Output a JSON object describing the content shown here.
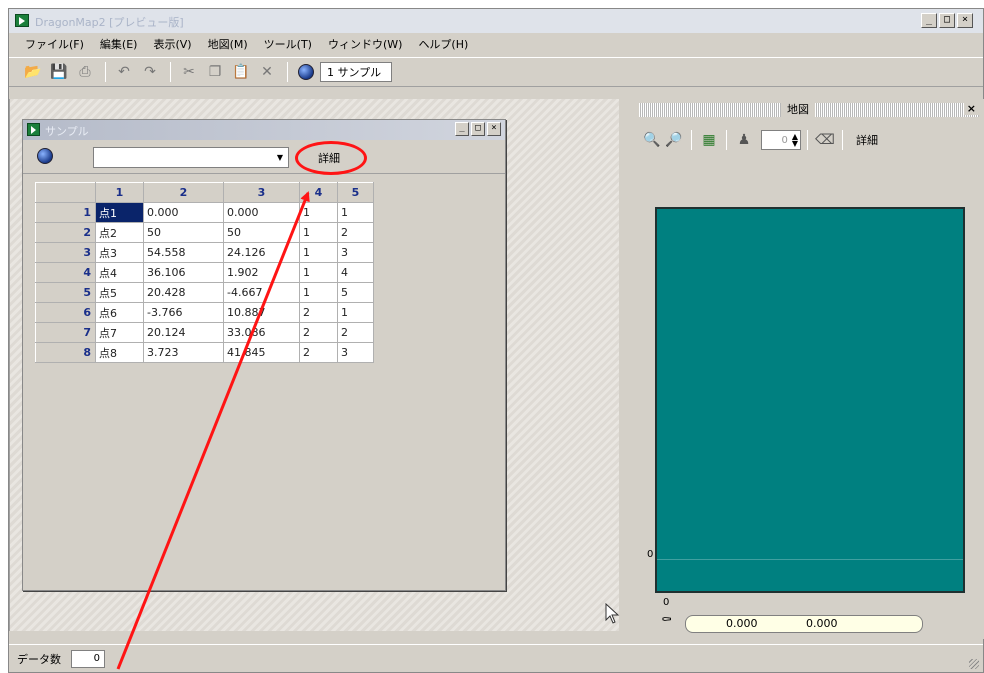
{
  "window": {
    "title": "DragonMap2 [プレビュー版]",
    "controls": {
      "minimize": "_",
      "maximize": "□",
      "close": "×"
    }
  },
  "menu": [
    {
      "label": "ファイル(F)"
    },
    {
      "label": "編集(E)"
    },
    {
      "label": "表示(V)"
    },
    {
      "label": "地図(M)"
    },
    {
      "label": "ツール(T)"
    },
    {
      "label": "ウィンドウ(W)"
    },
    {
      "label": "ヘルプ(H)"
    }
  ],
  "toolbar": {
    "icons": [
      "open-icon",
      "save-icon",
      "print-icon",
      "undo-icon",
      "redo-icon",
      "cut-icon",
      "copy-icon",
      "paste-icon",
      "delete-icon",
      "globe-icon"
    ],
    "combo_value": "1 サンプル"
  },
  "child_window": {
    "title": "サンプル",
    "name_combo_value": "",
    "detail_button_label": "詳細",
    "grid": {
      "columns": [
        "1",
        "2",
        "3",
        "4",
        "5"
      ],
      "rows": [
        {
          "index": "1",
          "cells": [
            "点1",
            "0.000",
            "0.000",
            "1",
            "1"
          ]
        },
        {
          "index": "2",
          "cells": [
            "点2",
            "50",
            "50",
            "1",
            "2"
          ]
        },
        {
          "index": "3",
          "cells": [
            "点3",
            "54.558",
            "24.126",
            "1",
            "3"
          ]
        },
        {
          "index": "4",
          "cells": [
            "点4",
            "36.106",
            "1.902",
            "1",
            "4"
          ]
        },
        {
          "index": "5",
          "cells": [
            "点5",
            "20.428",
            "-4.667",
            "1",
            "5"
          ]
        },
        {
          "index": "6",
          "cells": [
            "点6",
            "-3.766",
            "10.887",
            "2",
            "1"
          ]
        },
        {
          "index": "7",
          "cells": [
            "点7",
            "20.124",
            "33.086",
            "2",
            "2"
          ]
        },
        {
          "index": "8",
          "cells": [
            "点8",
            "3.723",
            "41.845",
            "2",
            "3"
          ]
        }
      ],
      "selected_cell": "点1"
    }
  },
  "map_panel": {
    "title": "地図",
    "close_label": "×",
    "scale_value": "0",
    "detail_label": "詳細",
    "axis_y_label": "0",
    "axis_x_label": "0",
    "coord_x": "0.000",
    "coord_y": "0.000",
    "canvas_color": "#008080"
  },
  "status": {
    "label": "データ数",
    "value": "0"
  },
  "annotation": {
    "color": "#ff1414"
  }
}
